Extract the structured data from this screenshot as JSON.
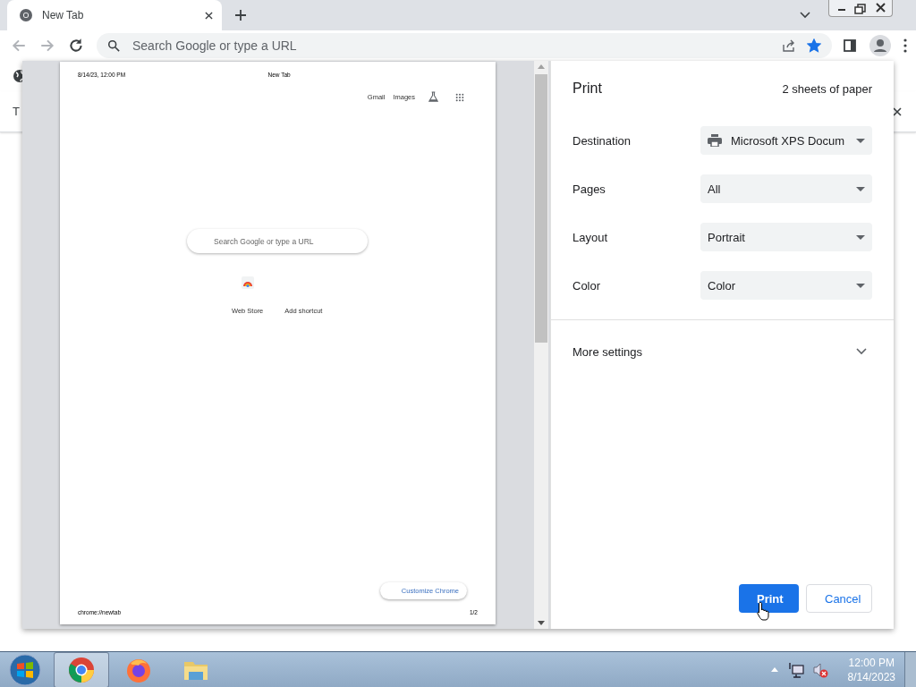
{
  "tabs": [
    {
      "title": "New Tab",
      "selected": true
    }
  ],
  "toolbar": {
    "address_placeholder": "Search Google or type a URL",
    "bookmarked": true
  },
  "background_page": {
    "text": "T"
  },
  "preview": {
    "header_date": "8/14/23, 12:00 PM",
    "header_title": "New Tab",
    "links": [
      "Gmail",
      "Images"
    ],
    "search_placeholder": "Search Google or type a URL",
    "shortcuts": [
      {
        "label": "Web Store",
        "kind": "store"
      },
      {
        "label": "Add shortcut",
        "kind": "blank"
      }
    ],
    "customize_button": "Customize Chrome",
    "footer_url": "chrome://newtab",
    "footer_page": "1/2"
  },
  "print_panel": {
    "title": "Print",
    "sheets": "2 sheets of paper",
    "settings": [
      {
        "label": "Destination",
        "value": "Microsoft XPS Docum",
        "kind": "printer"
      },
      {
        "label": "Pages",
        "value": "All",
        "kind": "plain"
      },
      {
        "label": "Layout",
        "value": "Portrait",
        "kind": "plain"
      },
      {
        "label": "Color",
        "value": "Color",
        "kind": "plain"
      }
    ],
    "more_settings": {
      "label": "More settings",
      "expanded": false
    },
    "buttons": [
      {
        "label": "Print",
        "kind": "primary"
      },
      {
        "label": "Cancel",
        "kind": "secondary"
      }
    ]
  },
  "taskbar": {
    "apps": [
      {
        "kind": "chrome",
        "selected": true
      },
      {
        "kind": "firefox",
        "selected": false
      },
      {
        "kind": "folder",
        "selected": false
      }
    ],
    "time": "12:00 PM",
    "date": "8/14/2023",
    "sound_muted": true
  }
}
